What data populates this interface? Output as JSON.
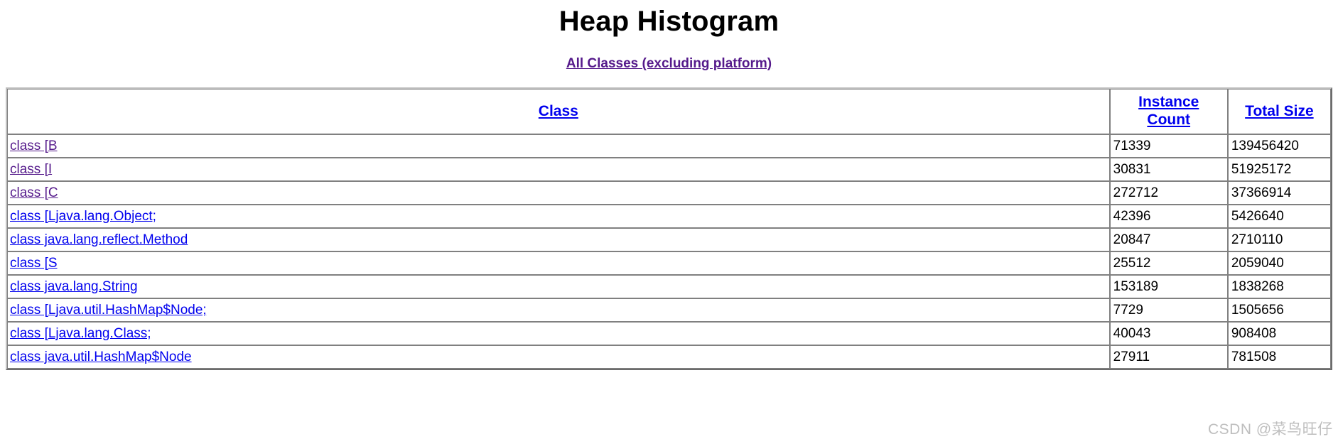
{
  "page": {
    "title": "Heap Histogram",
    "subtitle_link": "All Classes (excluding platform)",
    "watermark": "CSDN @菜鸟旺仔"
  },
  "colors": {
    "link_unvisited": "#0000ee",
    "link_visited": "#551a8b",
    "text": "#000000",
    "border": "#808080",
    "background": "#ffffff"
  },
  "table": {
    "headers": {
      "class": "Class",
      "instance_count": "Instance Count",
      "total_size": "Total Size"
    },
    "rows": [
      {
        "class": "class [B",
        "visited": true,
        "instance_count": "71339",
        "total_size": "139456420"
      },
      {
        "class": "class [I",
        "visited": true,
        "instance_count": "30831",
        "total_size": "51925172"
      },
      {
        "class": "class [C",
        "visited": true,
        "instance_count": "272712",
        "total_size": "37366914"
      },
      {
        "class": "class [Ljava.lang.Object;",
        "visited": false,
        "instance_count": "42396",
        "total_size": "5426640"
      },
      {
        "class": "class java.lang.reflect.Method",
        "visited": false,
        "instance_count": "20847",
        "total_size": "2710110"
      },
      {
        "class": "class [S",
        "visited": false,
        "instance_count": "25512",
        "total_size": "2059040"
      },
      {
        "class": "class java.lang.String",
        "visited": false,
        "instance_count": "153189",
        "total_size": "1838268"
      },
      {
        "class": "class [Ljava.util.HashMap$Node;",
        "visited": false,
        "instance_count": "7729",
        "total_size": "1505656"
      },
      {
        "class": "class [Ljava.lang.Class;",
        "visited": false,
        "instance_count": "40043",
        "total_size": "908408"
      },
      {
        "class": "class java.util.HashMap$Node",
        "visited": false,
        "instance_count": "27911",
        "total_size": "781508"
      }
    ]
  }
}
